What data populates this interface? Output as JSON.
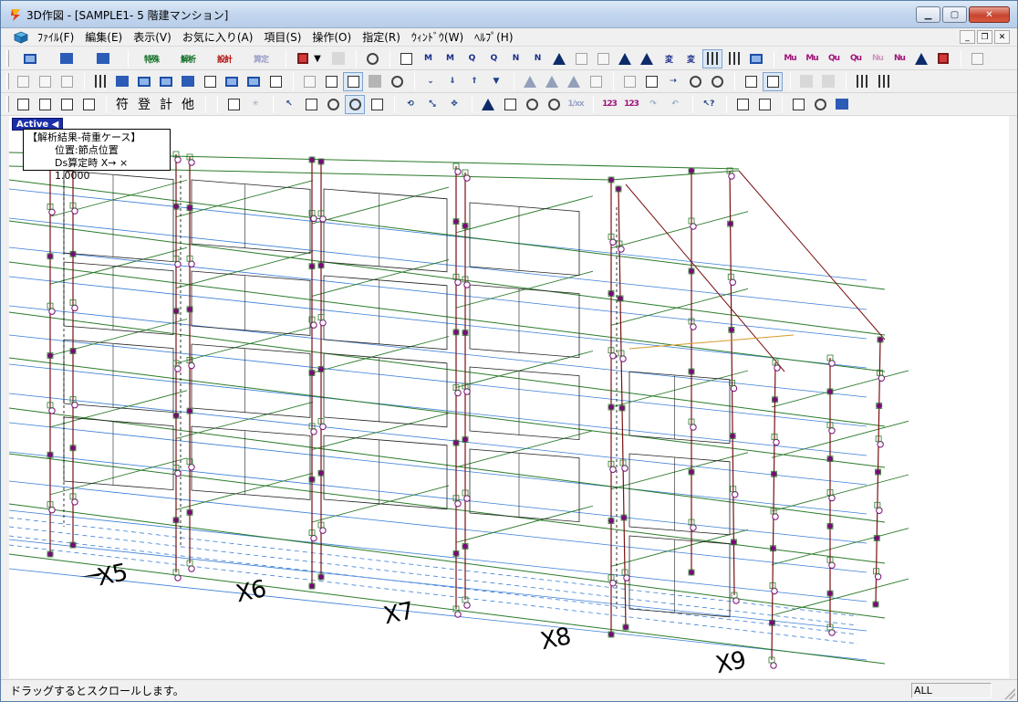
{
  "window": {
    "title": "3D作図 - [SAMPLE1- 5 階建マンション]",
    "app_icon": "app-logo-icon"
  },
  "menu": {
    "items": [
      {
        "label": "ﾌｧｲﾙ(F)"
      },
      {
        "label": "編集(E)"
      },
      {
        "label": "表示(V)"
      },
      {
        "label": "お気に入り(A)"
      },
      {
        "label": "項目(S)"
      },
      {
        "label": "操作(O)"
      },
      {
        "label": "指定(R)"
      },
      {
        "label": "ｳｨﾝﾄﾞｳ(W)"
      },
      {
        "label": "ﾍﾙﾌﾟ(H)"
      }
    ]
  },
  "toolbar1": {
    "tokuchou_label": "特殊",
    "kaiseki_label": "解析",
    "sekkei_label": "設計",
    "kentei_label": "算定",
    "hen_label": "変",
    "hen2_label": "変"
  },
  "toolbar3": {
    "fu_label": "符",
    "to_label": "登",
    "kei_label": "計",
    "ta_label": "他"
  },
  "viewport": {
    "active_badge": "Active",
    "info": {
      "line1": "【解析結果-荷重ケース】",
      "line2": "位置:節点位置",
      "line3": "Ds算定時 X→ × 1.0000"
    },
    "axes": [
      {
        "label": "X5"
      },
      {
        "label": "X6"
      },
      {
        "label": "X7"
      },
      {
        "label": "X8"
      },
      {
        "label": "X9"
      }
    ],
    "colors": {
      "beam_green": "#2a7a2a",
      "column_red": "#7a1010",
      "slab_blue": "#3a7fd6",
      "node_purple": "#7a0a78",
      "wall_black": "#222222"
    }
  },
  "status": {
    "message": "ドラッグするとスクロールします。",
    "panel": "ALL"
  }
}
